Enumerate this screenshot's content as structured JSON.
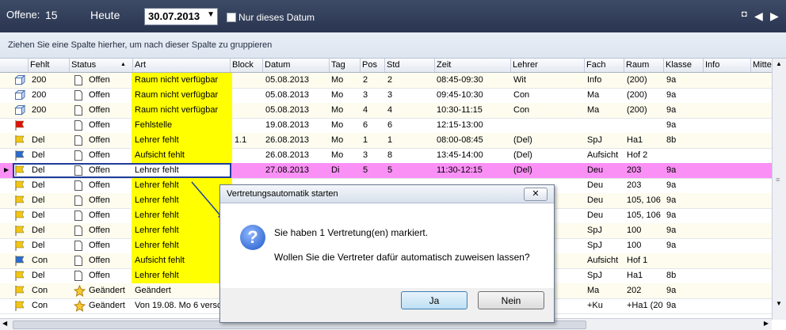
{
  "topbar": {
    "offene_label": "Offene:",
    "offene_count": "15",
    "heute": "Heute",
    "date": "30.07.2013",
    "checkbox_label": "Nur dieses Datum"
  },
  "groupbar": {
    "hint": "Ziehen Sie eine Spalte hierher, um nach dieser Spalte zu gruppieren"
  },
  "columns": [
    "Fehlt",
    "Status",
    "Art",
    "Block",
    "Datum",
    "Tag",
    "Pos",
    "Std",
    "Zeit",
    "Lehrer",
    "Fach",
    "Raum",
    "Klasse",
    "Info",
    "Mitte"
  ],
  "rows": [
    {
      "icon": "cube-icon",
      "fehlt": "200",
      "status": "Offen",
      "art": "Raum nicht verfügbar",
      "block": "",
      "datum": "05.08.2013",
      "tag": "Mo",
      "pos": "2",
      "std": "2",
      "zeit": "08:45-09:30",
      "lehrer": "Wit",
      "fach": "Info",
      "raum": "(200)",
      "klasse": "9a",
      "yellow": true,
      "star": false
    },
    {
      "icon": "cube-icon",
      "fehlt": "200",
      "status": "Offen",
      "art": "Raum nicht verfügbar",
      "block": "",
      "datum": "05.08.2013",
      "tag": "Mo",
      "pos": "3",
      "std": "3",
      "zeit": "09:45-10:30",
      "lehrer": "Con",
      "fach": "Ma",
      "raum": "(200)",
      "klasse": "9a",
      "yellow": true,
      "star": false
    },
    {
      "icon": "cube-icon",
      "fehlt": "200",
      "status": "Offen",
      "art": "Raum nicht verfügbar",
      "block": "",
      "datum": "05.08.2013",
      "tag": "Mo",
      "pos": "4",
      "std": "4",
      "zeit": "10:30-11:15",
      "lehrer": "Con",
      "fach": "Ma",
      "raum": "(200)",
      "klasse": "9a",
      "yellow": true,
      "star": false
    },
    {
      "icon": "red-flag-icon",
      "fehlt": "",
      "status": "Offen",
      "art": "Fehlstelle",
      "block": "",
      "datum": "19.08.2013",
      "tag": "Mo",
      "pos": "6",
      "std": "6",
      "zeit": "12:15-13:00",
      "lehrer": "",
      "fach": "",
      "raum": "",
      "klasse": "9a",
      "yellow": true,
      "star": false
    },
    {
      "icon": "yellow-flag-icon",
      "fehlt": "Del",
      "status": "Offen",
      "art": "Lehrer fehlt",
      "block": "1.1",
      "datum": "26.08.2013",
      "tag": "Mo",
      "pos": "1",
      "std": "1",
      "zeit": "08:00-08:45",
      "lehrer": "(Del)",
      "fach": "SpJ",
      "raum": "Ha1",
      "klasse": "8b",
      "yellow": true,
      "star": false
    },
    {
      "icon": "blue-flag-icon",
      "fehlt": "Del",
      "status": "Offen",
      "art": "Aufsicht fehlt",
      "block": "",
      "datum": "26.08.2013",
      "tag": "Mo",
      "pos": "3",
      "std": "8",
      "zeit": "13:45-14:00",
      "lehrer": "(Del)",
      "fach": "Aufsicht",
      "raum": "Hof 2",
      "klasse": "",
      "yellow": true,
      "star": false
    },
    {
      "icon": "yellow-flag-icon",
      "fehlt": "Del",
      "status": "Offen",
      "art": "Lehrer fehlt",
      "block": "",
      "datum": "27.08.2013",
      "tag": "Di",
      "pos": "5",
      "std": "5",
      "zeit": "11:30-12:15",
      "lehrer": "(Del)",
      "fach": "Deu",
      "raum": "203",
      "klasse": "9a",
      "yellow": false,
      "star": false,
      "selected": true
    },
    {
      "icon": "yellow-flag-icon",
      "fehlt": "Del",
      "status": "Offen",
      "art": "Lehrer fehlt",
      "block": "",
      "datum": "",
      "tag": "",
      "pos": "",
      "std": "",
      "zeit": "",
      "lehrer": "",
      "fach": "Deu",
      "raum": "203",
      "klasse": "9a",
      "yellow": true,
      "star": false
    },
    {
      "icon": "yellow-flag-icon",
      "fehlt": "Del",
      "status": "Offen",
      "art": "Lehrer fehlt",
      "block": "",
      "datum": "",
      "tag": "",
      "pos": "",
      "std": "",
      "zeit": "",
      "lehrer": "",
      "fach": "Deu",
      "raum": "105, 106",
      "klasse": "9a",
      "yellow": true,
      "star": false
    },
    {
      "icon": "yellow-flag-icon",
      "fehlt": "Del",
      "status": "Offen",
      "art": "Lehrer fehlt",
      "block": "",
      "datum": "",
      "tag": "",
      "pos": "",
      "std": "",
      "zeit": "",
      "lehrer": "",
      "fach": "Deu",
      "raum": "105, 106",
      "klasse": "9a",
      "yellow": true,
      "star": false
    },
    {
      "icon": "yellow-flag-icon",
      "fehlt": "Del",
      "status": "Offen",
      "art": "Lehrer fehlt",
      "block": "",
      "datum": "",
      "tag": "",
      "pos": "",
      "std": "",
      "zeit": "",
      "lehrer": "",
      "fach": "SpJ",
      "raum": "100",
      "klasse": "9a",
      "yellow": true,
      "star": false
    },
    {
      "icon": "yellow-flag-icon",
      "fehlt": "Del",
      "status": "Offen",
      "art": "Lehrer fehlt",
      "block": "",
      "datum": "",
      "tag": "",
      "pos": "",
      "std": "",
      "zeit": "",
      "lehrer": "",
      "fach": "SpJ",
      "raum": "100",
      "klasse": "9a",
      "yellow": true,
      "star": false
    },
    {
      "icon": "blue-flag-icon",
      "fehlt": "Con",
      "status": "Offen",
      "art": "Aufsicht fehlt",
      "block": "",
      "datum": "",
      "tag": "",
      "pos": "",
      "std": "",
      "zeit": "",
      "lehrer": "",
      "fach": "Aufsicht",
      "raum": "Hof 1",
      "klasse": "",
      "yellow": true,
      "star": false
    },
    {
      "icon": "yellow-flag-icon",
      "fehlt": "Del",
      "status": "Offen",
      "art": "Lehrer fehlt",
      "block": "",
      "datum": "",
      "tag": "",
      "pos": "",
      "std": "",
      "zeit": "",
      "lehrer": "",
      "fach": "SpJ",
      "raum": "Ha1",
      "klasse": "8b",
      "yellow": true,
      "star": false
    },
    {
      "icon": "yellow-flag-icon",
      "fehlt": "Con",
      "status": "Geändert",
      "art": "Geändert",
      "block": "",
      "datum": "",
      "tag": "",
      "pos": "",
      "std": "",
      "zeit": "",
      "lehrer": ")",
      "fach": "Ma",
      "raum": "202",
      "klasse": "9a",
      "yellow": false,
      "star": true
    },
    {
      "icon": "yellow-flag-icon",
      "fehlt": "Con",
      "status": "Geändert",
      "art": "Von 19.08. Mo 6 versc",
      "block": "",
      "datum": "",
      "tag": "",
      "pos": "",
      "std": "",
      "zeit": "",
      "lehrer": ")",
      "fach": "+Ku",
      "raum": "+Ha1 (20",
      "klasse": "9a",
      "yellow": false,
      "star": true
    }
  ],
  "dialog": {
    "title": "Vertretungsautomatik starten",
    "message1": "Sie haben 1 Vertretung(en) markiert.",
    "message2": "Wollen Sie die Vertreter dafür automatisch zuweisen lassen?",
    "ok": "Ja",
    "cancel": "Nein",
    "close": "✕"
  },
  "colors": {
    "header_bg": "#2a3550",
    "yellow": "#ffff00",
    "selected_row": "#fa90f5"
  }
}
